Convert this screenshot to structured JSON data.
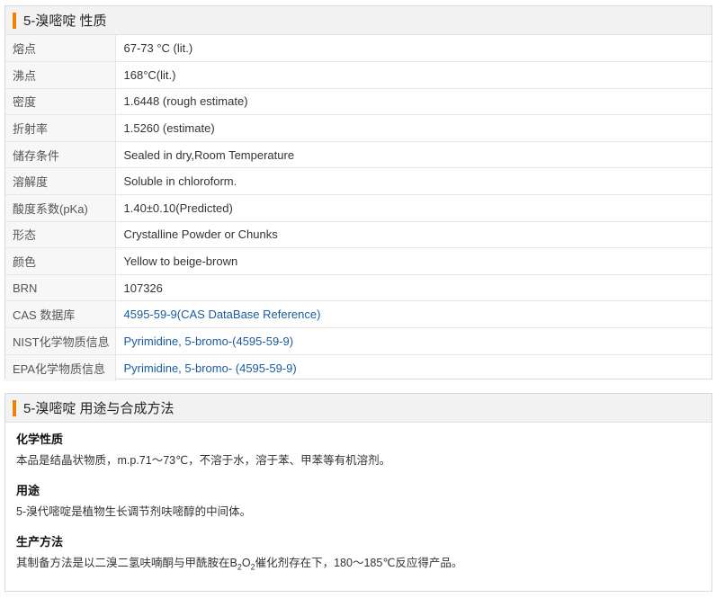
{
  "properties": {
    "title": "5-溴嘧啶 性质",
    "rows": [
      {
        "label": "熔点",
        "value": "67-73 °C (lit.)"
      },
      {
        "label": "沸点",
        "value": "168°C(lit.)"
      },
      {
        "label": "密度",
        "value": "1.6448 (rough estimate)"
      },
      {
        "label": "折射率",
        "value": "1.5260 (estimate)"
      },
      {
        "label": "储存条件",
        "value": "Sealed in dry,Room Temperature"
      },
      {
        "label": "溶解度",
        "value": "Soluble in chloroform."
      },
      {
        "label": "酸度系数(pKa)",
        "value": "1.40±0.10(Predicted)"
      },
      {
        "label": "形态",
        "value": "Crystalline Powder or Chunks"
      },
      {
        "label": "颜色",
        "value": "Yellow to beige-brown"
      },
      {
        "label": "BRN",
        "value": "107326"
      },
      {
        "label": "CAS 数据库",
        "value": "4595-59-9(CAS DataBase Reference)"
      },
      {
        "label": "NIST化学物质信息",
        "value": "Pyrimidine, 5-bromo-(4595-59-9)"
      },
      {
        "label": "EPA化学物质信息",
        "value": "Pyrimidine, 5-bromo- (4595-59-9)"
      }
    ]
  },
  "usage": {
    "title": "5-溴嘧啶 用途与合成方法",
    "chem_title": "化学性质",
    "chem_text": "本品是结晶状物质，m.p.71～73℃，不溶于水，溶于苯、甲苯等有机溶剂。",
    "use_title": "用途",
    "use_text": "5-溴代嘧啶是植物生长调节剂呋嘧醇的中间体。",
    "prod_title": "生产方法",
    "prod_text_before": "其制备方法是以二溴二氢呋喃酮与甲酰胺在B",
    "prod_sub1": "2",
    "prod_mid": "O",
    "prod_sub2": "2",
    "prod_text_after": "催化剂存在下，180～185℃反应得产品。"
  },
  "colors": {
    "accent": "#f08200",
    "link": "#1a5a9e",
    "header_bg": "#f2f2f2"
  }
}
